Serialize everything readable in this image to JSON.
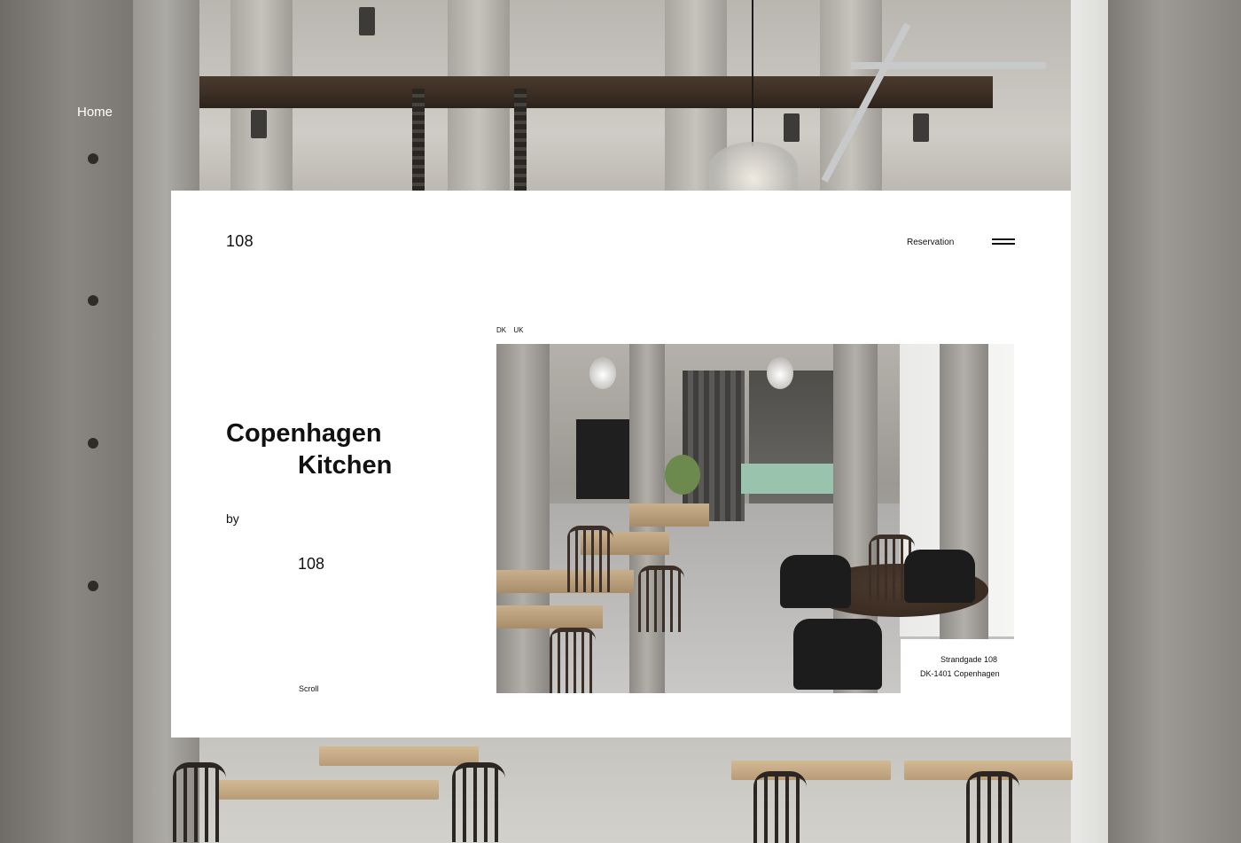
{
  "background_nav": {
    "home_label": "Home"
  },
  "header": {
    "logo": "108",
    "reservation_label": "Reservation",
    "menu_icon": "hamburger-menu-icon"
  },
  "hero": {
    "title_line1": "Copenhagen",
    "title_line2": "Kitchen",
    "by_label": "by",
    "brand": "108",
    "scroll_label": "Scroll"
  },
  "languages": [
    "DK",
    "UK"
  ],
  "address": {
    "line1": "Strandgade 108",
    "line2": "DK-1401 Copenhagen"
  },
  "colors": {
    "card_background": "#ffffff",
    "text": "#111111",
    "nav_text": "#ffffff"
  }
}
